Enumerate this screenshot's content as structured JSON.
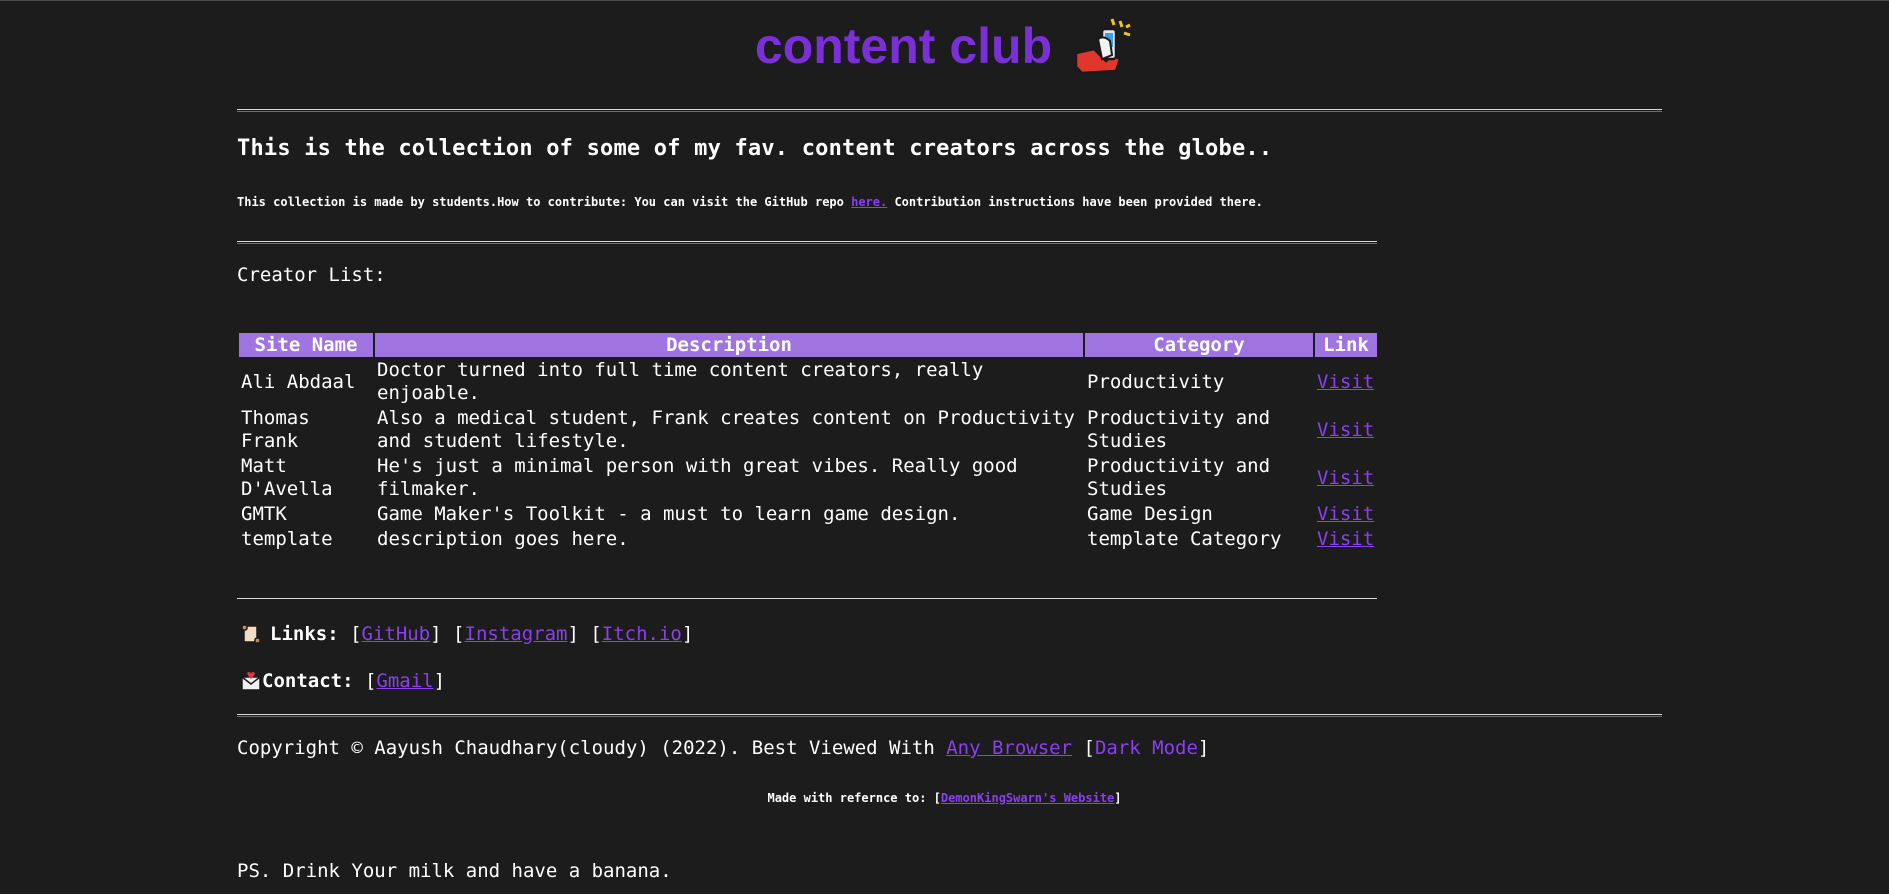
{
  "header": {
    "title": "content club",
    "icon": "hand-holding-phone-icon"
  },
  "intro": {
    "heading": "This is the collection of some of my fav. content creators across the globe..",
    "note_before": "This collection is made by students.How to contribute: You can visit the GitHub repo ",
    "note_link": "here.",
    "note_after": " Contribution instructions have been provided there."
  },
  "creators": {
    "heading": "Creator List:",
    "columns": [
      "Site Name",
      "Description",
      "Category",
      "Link"
    ],
    "rows": [
      {
        "site": "Ali Abdaal",
        "description": "Doctor turned into full time content creators, really enjoable.",
        "category": "Productivity",
        "link": "Visit"
      },
      {
        "site": "Thomas Frank",
        "description": "Also a medical student, Frank creates content on Productivity and student lifestyle.",
        "category": "Productivity and Studies",
        "link": "Visit"
      },
      {
        "site": "Matt D'Avella",
        "description": "He's just a minimal person with great vibes. Really good filmaker.",
        "category": "Productivity and Studies",
        "link": "Visit"
      },
      {
        "site": "GMTK",
        "description": "Game Maker's Toolkit - a must to learn game design.",
        "category": "Game Design",
        "link": "Visit"
      },
      {
        "site": "template",
        "description": "description goes here.",
        "category": "template Category",
        "link": "Visit"
      }
    ]
  },
  "links": {
    "icon": "scroll-icon",
    "label": "Links:",
    "items": [
      "GitHub",
      "Instagram",
      "Itch.io"
    ]
  },
  "contact": {
    "icon": "envelope-with-heart-icon",
    "label": "Contact:",
    "items": [
      "Gmail"
    ]
  },
  "footer": {
    "copyright": "Copyright © Aayush Chaudhary(cloudy) (2022). Best Viewed With ",
    "browser_link": "Any Browser",
    "dark_mode": "Dark Mode",
    "made_with_label": "Made with refernce to: ",
    "made_with_link": "DemonKingSwarn's Website",
    "ps": "PS. Drink Your milk and have a banana."
  },
  "colors": {
    "background": "#1c1c1c",
    "accent": "#7b2fd6",
    "link": "#8a3ff0",
    "table_header": "#a074e0",
    "text": "#ffffff"
  }
}
